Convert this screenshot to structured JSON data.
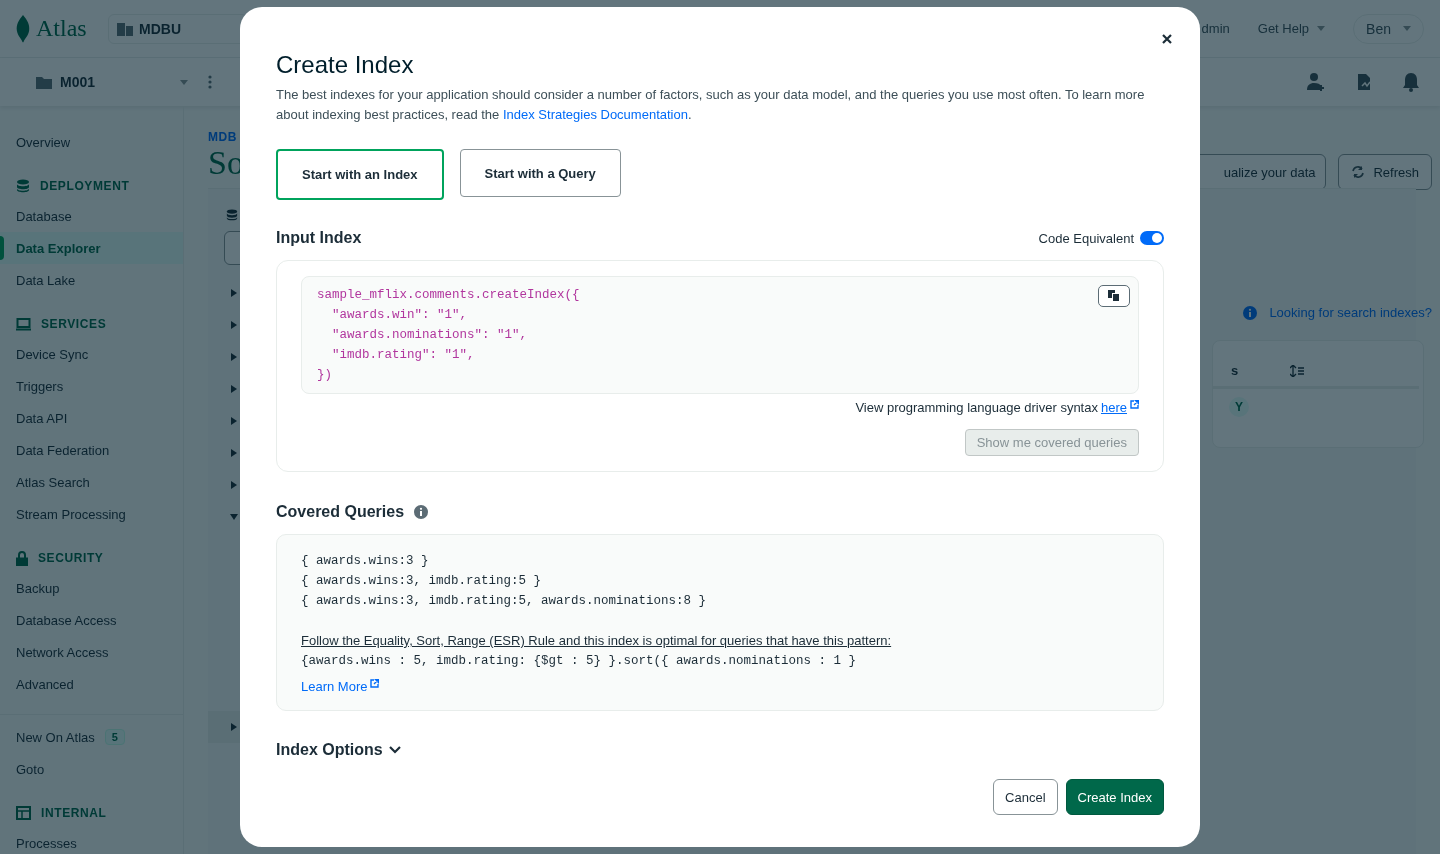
{
  "nav": {
    "logo": "Atlas",
    "org": "MDBU",
    "top_links": [
      {
        "label": "dmin",
        "caret": false
      },
      {
        "label": "Get Help",
        "caret": true
      }
    ],
    "user": "Ben",
    "project": "M001"
  },
  "sidebar": [
    {
      "items": [
        {
          "label": "Overview",
          "selected": false
        }
      ]
    },
    {
      "kind": "database",
      "title": "DEPLOYMENT",
      "items": [
        {
          "label": "Database",
          "selected": false
        },
        {
          "label": "Data Explorer",
          "selected": true
        },
        {
          "label": "Data Lake",
          "selected": false
        }
      ]
    },
    {
      "kind": "monitor",
      "title": "SERVICES",
      "items": [
        {
          "label": "Device Sync",
          "selected": false
        },
        {
          "label": "Triggers",
          "selected": false
        },
        {
          "label": "Data API",
          "selected": false
        },
        {
          "label": "Data Federation",
          "selected": false
        },
        {
          "label": "Atlas Search",
          "selected": false
        },
        {
          "label": "Stream Processing",
          "selected": false
        }
      ]
    },
    {
      "kind": "lock",
      "title": "SECURITY",
      "items": [
        {
          "label": "Backup",
          "selected": false
        },
        {
          "label": "Database Access",
          "selected": false
        },
        {
          "label": "Network Access",
          "selected": false
        },
        {
          "label": "Advanced",
          "selected": false
        }
      ]
    },
    {
      "items": [
        {
          "label": "New On Atlas",
          "selected": false,
          "badge": "5"
        },
        {
          "label": "Goto",
          "selected": false
        }
      ]
    },
    {
      "kind": "table",
      "title": "INTERNAL",
      "items": [
        {
          "label": "Processes",
          "selected": false
        }
      ]
    }
  ],
  "page": {
    "breadcrumb": "MDB",
    "title": "So",
    "buttons": [
      "ualize your data",
      "Refresh"
    ],
    "search_link": "Looking for search indexes?",
    "table_header": "s",
    "status_badge": "Y",
    "tree": [
      {
        "expanded": false
      },
      {
        "expanded": false
      },
      {
        "expanded": false
      },
      {
        "expanded": false
      },
      {
        "expanded": false
      },
      {
        "expanded": false
      },
      {
        "expanded": false
      },
      {
        "expanded": true
      },
      {
        "expanded": false
      }
    ]
  },
  "modal": {
    "title": "Create Index",
    "description": "The best indexes for your application should consider a number of factors, such as your data model, and the queries you use most often. To learn more about indexing best practices, read the ",
    "description_link": "Index Strategies Documentation",
    "description_end": ".",
    "tabs": [
      {
        "label": "Start with an Index",
        "selected": true
      },
      {
        "label": "Start with a Query",
        "selected": false
      }
    ],
    "input_index": {
      "heading": "Input Index",
      "toggle_label": "Code Equivalent",
      "toggle_on": true,
      "code": [
        "sample_mflix.comments.createIndex({",
        "  \"awards.win\": \"1\",",
        "  \"awards.nominations\": \"1\",",
        "  \"imdb.rating\": \"1\",",
        "})"
      ],
      "driver_text": "View programming language driver syntax",
      "driver_link": "here",
      "covered_button": {
        "label": "Show me covered queries",
        "disabled": true
      }
    },
    "covered": {
      "heading": "Covered Queries",
      "queries": [
        "{ awards.wins:3 }",
        "{ awards.wins:3, imdb.rating:5 }",
        "{ awards.wins:3, imdb.rating:5, awards.nominations:8 }"
      ],
      "esr_text": "Follow the Equality, Sort, Range (ESR) Rule and this index is optimal for queries that have this pattern:",
      "pattern": "{awards.wins : 5, imdb.rating: {$gt : 5} }.sort({ awards.nominations : 1 }",
      "learn_more": "Learn More"
    },
    "options": {
      "label": "Index Options",
      "expanded": false
    },
    "buttons": [
      {
        "label": "Cancel",
        "kind": "secondary"
      },
      {
        "label": "Create Index",
        "kind": "primary"
      }
    ]
  }
}
